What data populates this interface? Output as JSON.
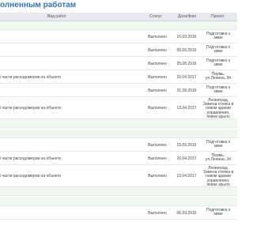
{
  "page": {
    "title": "олненным работам"
  },
  "table": {
    "headers": {
      "work": "Вид работ",
      "status": "Статус",
      "date": "Дата/Факт",
      "project": "Проект"
    },
    "rows": [
      {
        "work": "",
        "status": "Выполнен",
        "date": "15.09.2016",
        "project": "Подготовка к зиме"
      },
      {
        "work": "",
        "status": "Выполнен",
        "date": "06.09.2016",
        "project": "Подготовка к зиме"
      },
      {
        "work": "",
        "status": "Выполнен",
        "date": "25.08.2016",
        "project": "Подготовка к зиме"
      },
      {
        "work": "і части расходомеров на объекте",
        "status": "Выполнен",
        "date": "20.04.2017",
        "project": "Пермь, ул.Ленина, 34"
      },
      {
        "work": "",
        "status": "Выполнен",
        "date": "31.08.2016",
        "project": "Подготовка к зиме"
      },
      {
        "work": "і части расходомеров на объекте",
        "status": "Выполнен",
        "date": "13.04.2017",
        "project": "Ленинград, Замена стояка в новом здании управления, левое крыло"
      },
      {
        "work": "",
        "status": "Выполнен",
        "date": "15.09.2016",
        "project": "Подготовка к зиме"
      },
      {
        "work": "і части расходомеров на объекте",
        "status": "Выполнен",
        "date": "20.04.2017",
        "project": "Пермь, ул.Ленина, 34"
      },
      {
        "work": "і части расходомеров на объекте",
        "status": "Выполнен",
        "date": "13.04.2017",
        "project": "Ленинград, Замена стояка в новом здании управления, левое крыло"
      },
      {
        "work": "",
        "status": "Выполнен",
        "date": "06.09.2016",
        "project": "Подготовка к зиме"
      }
    ]
  }
}
